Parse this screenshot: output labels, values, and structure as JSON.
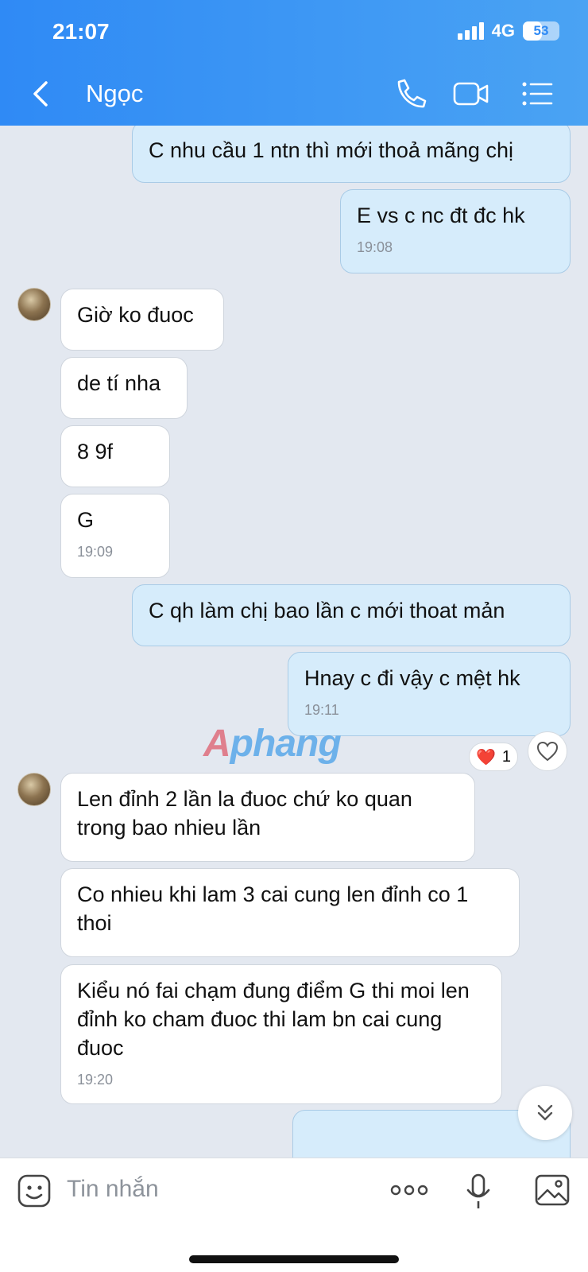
{
  "status_bar": {
    "time": "21:07",
    "network": "4G",
    "battery": "53",
    "battery_fraction": 0.53
  },
  "header": {
    "title": "Ngọc",
    "icons": [
      "back-icon",
      "phone-icon",
      "video-call-icon",
      "menu-list-icon"
    ]
  },
  "messages": [
    {
      "from": "me",
      "text": "C nhu cầu 1 ntn thì mới thoả mãng chị"
    },
    {
      "from": "me",
      "text": "E vs c nc đt đc hk",
      "time": "19:08"
    },
    {
      "from": "contact",
      "text": "Giờ ko đuoc"
    },
    {
      "from": "contact",
      "text": "de tí nha"
    },
    {
      "from": "contact",
      "text": "8 9f"
    },
    {
      "from": "contact",
      "text": "G",
      "time": "19:09"
    },
    {
      "from": "me",
      "text": "C qh làm chị bao lần c mới thoat mản"
    },
    {
      "from": "me",
      "text": "Hnay c đi vậy c mệt hk",
      "time": "19:11"
    },
    {
      "from": "contact",
      "text": "Len đỉnh 2 lần la đuoc chứ ko quan trong bao nhieu lần"
    },
    {
      "from": "contact",
      "text": "Co nhieu khi lam 3 cai cung len đỉnh co 1 thoi"
    },
    {
      "from": "contact",
      "text": "Kiểu nó fai chạm đung điểm G thi moi len đỉnh ko cham đuoc thi lam bn cai cung đuoc",
      "time": "19:20"
    }
  ],
  "reaction": {
    "emoji": "❤️",
    "count": "1"
  },
  "watermark": {
    "part1": "A",
    "part2": "phang"
  },
  "input": {
    "placeholder": "Tin nhắn"
  },
  "colors": {
    "header_start": "#2f8af5",
    "header_end": "#4aa3f3",
    "outgoing_bubble": "#d6ecfb",
    "incoming_bubble": "#ffffff",
    "chat_bg": "#e3e8f0"
  }
}
